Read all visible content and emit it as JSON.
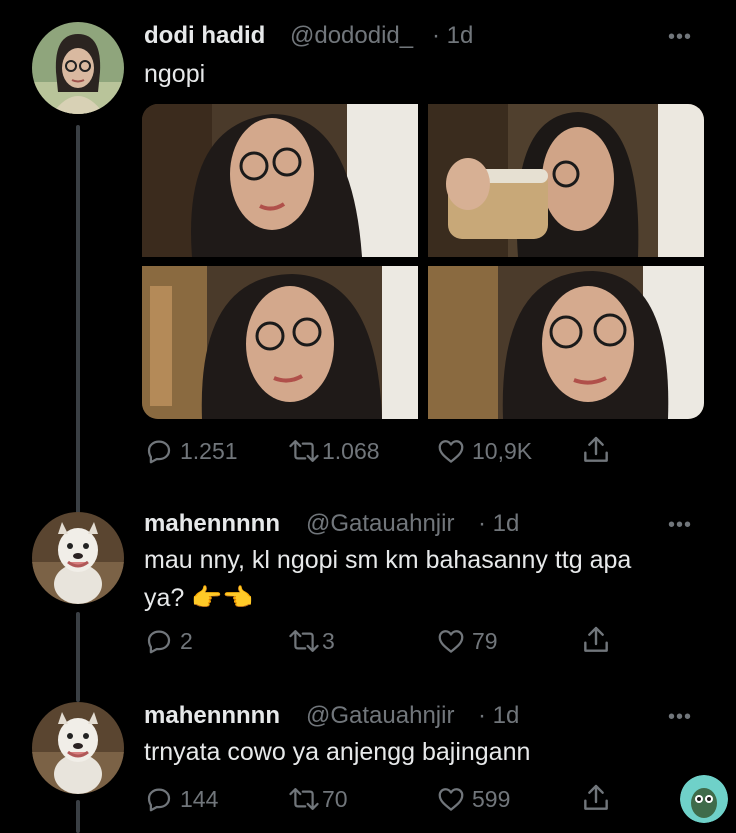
{
  "tweet": {
    "author_name": "dodi hadid",
    "handle": "@dododid_",
    "time": "· 1d",
    "text": "ngopi",
    "more": "•••",
    "stats": {
      "replies": "1.251",
      "retweets": "1.068",
      "likes": "10,9K"
    }
  },
  "replies": [
    {
      "author_name": "mahennnnn",
      "handle": "@Gatauahnjir",
      "time": "· 1d",
      "text_line1": "mau nny, kl ngopi sm km bahasanny ttg apa",
      "text_line2": "ya? 👉👈",
      "more": "•••",
      "stats": {
        "replies": "2",
        "retweets": "3",
        "likes": "79"
      }
    },
    {
      "author_name": "mahennnnn",
      "handle": "@Gatauahnjir",
      "time": "· 1d",
      "text_line1": "trnyata cowo ya anjengg bajingann",
      "more": "•••",
      "stats": {
        "replies": "144",
        "retweets": "70",
        "likes": "599"
      }
    }
  ],
  "icons": [
    "reply-icon",
    "retweet-icon",
    "like-icon",
    "share-icon",
    "more-icon"
  ],
  "colors": {
    "background": "#000000",
    "text": "#e7e9ea",
    "muted": "#71767b",
    "thread_line": "#3a3f44"
  }
}
